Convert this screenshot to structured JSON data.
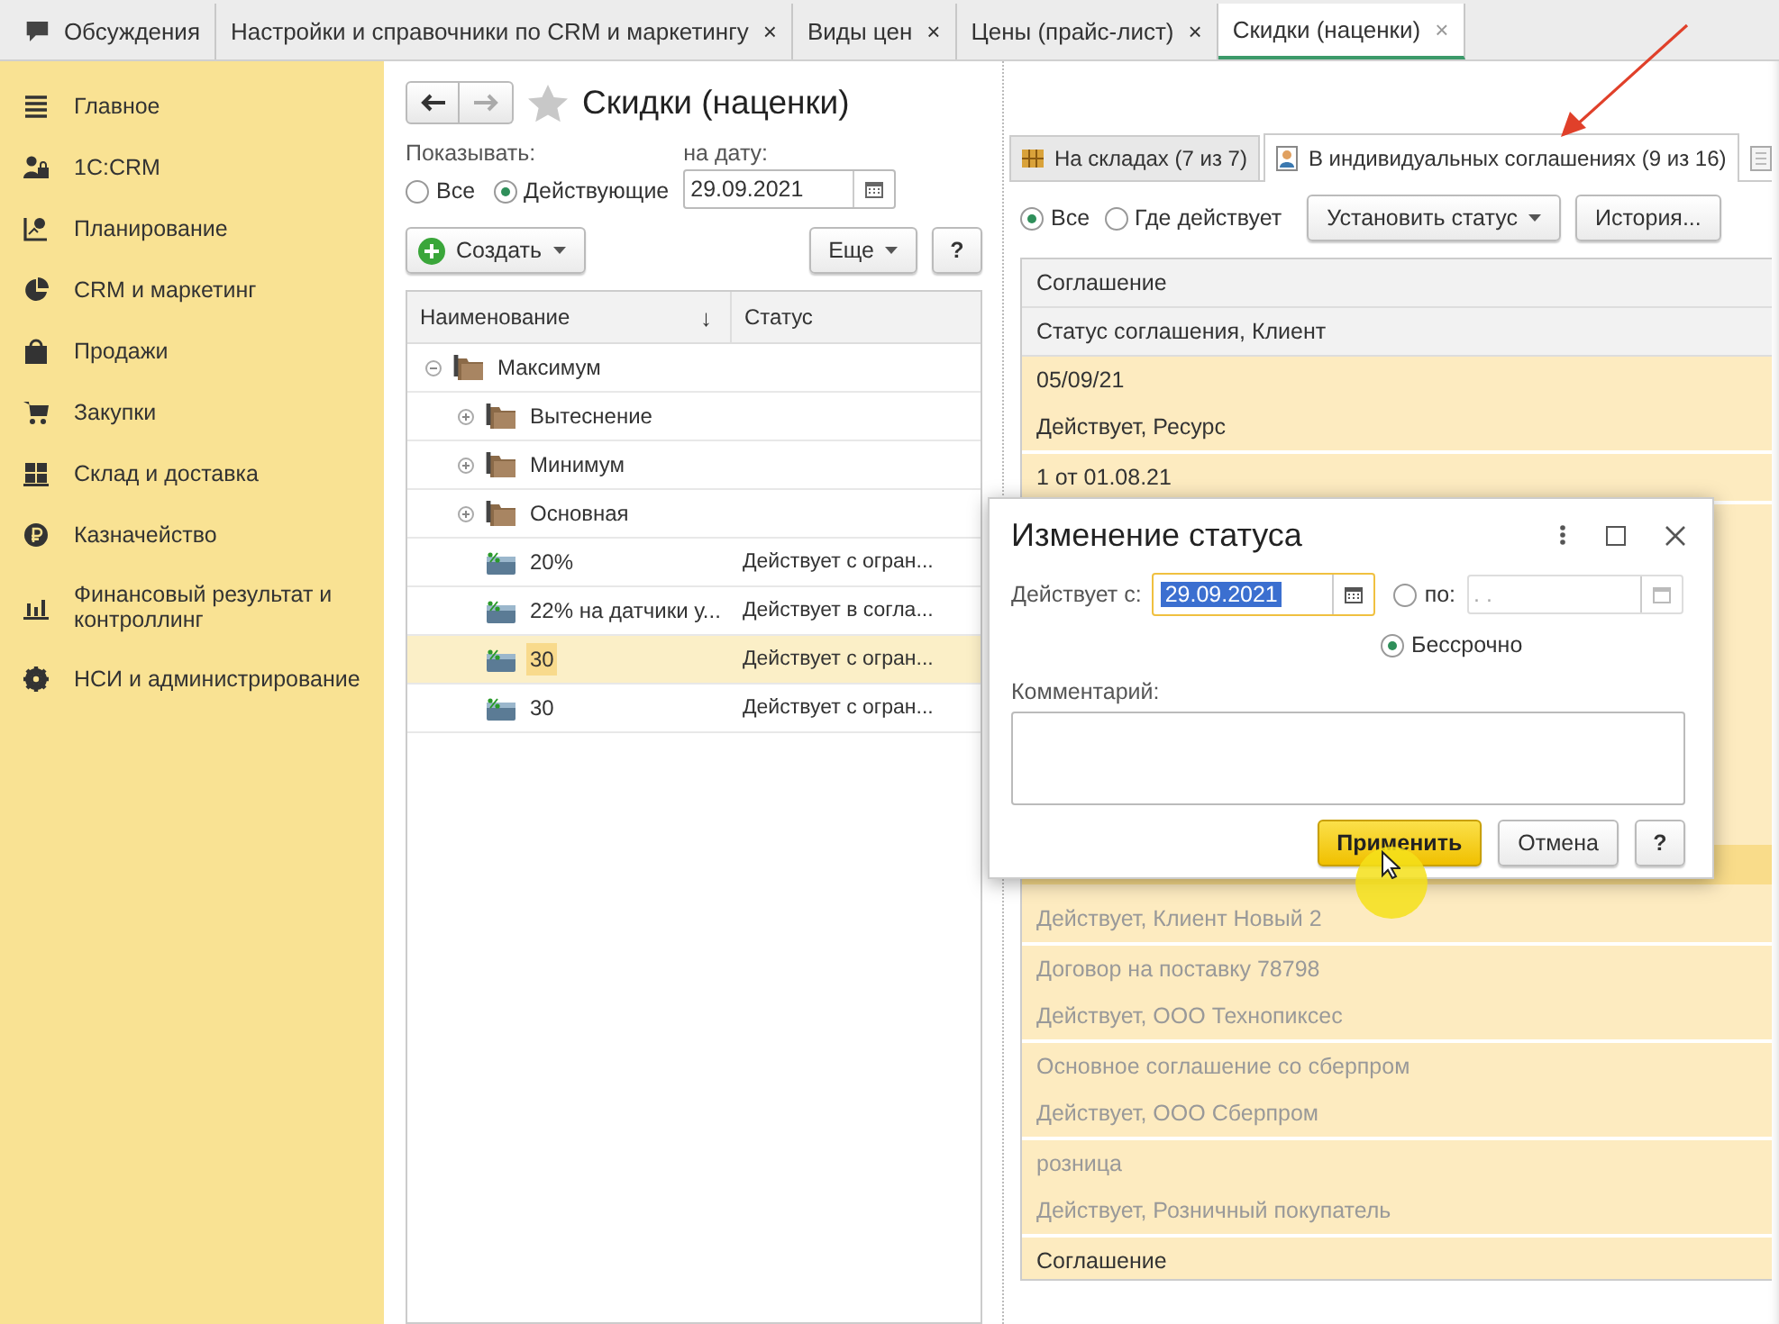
{
  "top_tabs": [
    {
      "label": "Обсуждения",
      "kind": "home",
      "selected": false
    },
    {
      "label": "Настройки и справочники по CRM и маркетингу",
      "kind": "page",
      "close": "×",
      "selected": false
    },
    {
      "label": "Виды цен",
      "kind": "page",
      "close": "×",
      "selected": false
    },
    {
      "label": "Цены (прайс-лист)",
      "kind": "page",
      "close": "×",
      "selected": false
    },
    {
      "label": "Скидки (наценки)",
      "kind": "page",
      "close": "×",
      "selected": true
    }
  ],
  "sidebar": {
    "items": [
      {
        "label": "Главное"
      },
      {
        "label": "1С:CRM"
      },
      {
        "label": "Планирование"
      },
      {
        "label": "CRM и маркетинг"
      },
      {
        "label": "Продажи"
      },
      {
        "label": "Закупки"
      },
      {
        "label": "Склад и доставка"
      },
      {
        "label": "Казначейство"
      },
      {
        "label": "Финансовый результат и контроллинг"
      },
      {
        "label": "НСИ и администрирование"
      }
    ]
  },
  "form": {
    "title": "Скидки (наценки)",
    "show_label": "Показывать:",
    "show_options": [
      {
        "label": "Все",
        "selected": false
      },
      {
        "label": "Действующие",
        "selected": true
      }
    ],
    "date_label": "на дату:",
    "date_value": "29.09.2021",
    "buttons": [
      {
        "kind": "create",
        "label": "Создать"
      },
      {
        "kind": "more",
        "label": "Еще"
      },
      {
        "kind": "help",
        "label": "?"
      }
    ],
    "table": {
      "columns": [
        {
          "label": "Наименование",
          "sort": "↓"
        },
        {
          "label": "Статус"
        }
      ],
      "rows": [
        {
          "kind": "group",
          "name": "Максимум",
          "expanded": true,
          "selected": false,
          "children": [
            {
              "kind": "group",
              "name": "Вытеснение",
              "expanded": false,
              "selected": false
            },
            {
              "kind": "group",
              "name": "Минимум",
              "expanded": false,
              "selected": false
            },
            {
              "kind": "group",
              "name": "Основная",
              "expanded": false,
              "selected": false
            },
            {
              "kind": "discount",
              "name": "20%",
              "status": "Действует с огран...",
              "selected": false
            },
            {
              "kind": "discount",
              "name": "22% на датчики у...",
              "status": "Действует в согла...",
              "selected": false
            },
            {
              "kind": "discount",
              "name": "30",
              "status": "Действует с огран...",
              "selected": true
            },
            {
              "kind": "discount",
              "name": "30",
              "status": "Действует с огран...",
              "selected": false
            }
          ]
        }
      ]
    }
  },
  "details": {
    "tabs": [
      {
        "label": "На складах (7 из 7)",
        "selected": false
      },
      {
        "label": "В индивидуальных соглашениях (9 из 16)",
        "selected": true
      }
    ],
    "filter": [
      {
        "label": "Все",
        "selected": true
      },
      {
        "label": "Где действует",
        "selected": false
      }
    ],
    "buttons": [
      {
        "kind": "menu",
        "label": "Установить статус"
      },
      {
        "kind": "plain",
        "label": "История..."
      }
    ],
    "header_lines": [
      "Соглашение",
      "Статус соглашения, Клиент"
    ],
    "rows_above": [
      {
        "lines": [
          "05/09/21",
          "Действует, Ресурс"
        ],
        "dimmed": false
      },
      {
        "lines": [
          "1 от 01.08.21"
        ],
        "dimmed": false
      }
    ],
    "rows_below": [
      {
        "lines": [
          "Действует, Клиент Новый 2"
        ],
        "dimmed": true
      },
      {
        "lines": [
          "Договор на поставку 78798",
          "Действует, ООО Технопиксес"
        ],
        "dimmed": true
      },
      {
        "lines": [
          "Основное соглашение со сберпром",
          "Действует, ООО Сберпром"
        ],
        "dimmed": true
      },
      {
        "lines": [
          "розница",
          "Действует, Розничный покупатель"
        ],
        "dimmed": true
      },
      {
        "lines": [
          "Соглашение"
        ],
        "dimmed": false
      }
    ]
  },
  "dialog": {
    "title": "Изменение статуса",
    "from_label": "Действует с:",
    "from_value": "29.09.2021",
    "to_option": {
      "label": "по:",
      "selected": false
    },
    "to_value": ". .",
    "forever_option": {
      "label": "Бессрочно",
      "selected": true
    },
    "comment_label": "Комментарий:",
    "buttons": [
      {
        "kind": "default",
        "label": "Применить"
      },
      {
        "kind": "plain",
        "label": "Отмена"
      },
      {
        "kind": "help",
        "label": "?"
      }
    ]
  }
}
